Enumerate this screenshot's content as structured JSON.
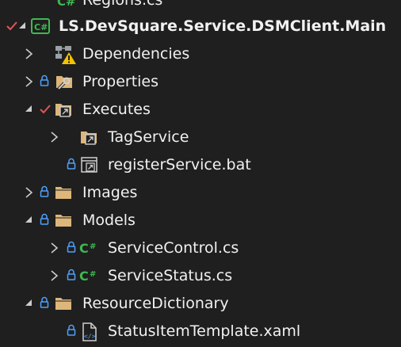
{
  "tree": {
    "top_partial_label": "Regions.cs",
    "project": {
      "label": "LS.DevSquare.Service.DSMClient.Main"
    },
    "items": [
      {
        "label": "Dependencies"
      },
      {
        "label": "Properties"
      },
      {
        "label": "Executes"
      },
      {
        "label": "TagService"
      },
      {
        "label": "registerService.bat"
      },
      {
        "label": "Images"
      },
      {
        "label": "Models"
      },
      {
        "label": "ServiceControl.cs"
      },
      {
        "label": "ServiceStatus.cs"
      },
      {
        "label": "ResourceDictionary"
      },
      {
        "label": "StatusItemTemplate.xaml"
      }
    ]
  },
  "icons": {
    "folder": "folder-icon",
    "csharp_project": "csharp-project-icon",
    "csharp_file": "csharp-file-icon",
    "dependencies": "dependencies-warning-icon",
    "properties": "properties-folder-icon",
    "shortcut_folder": "shortcut-folder-icon",
    "bat_file": "batch-file-icon",
    "xaml_file": "xaml-file-icon",
    "lock": "lock-icon",
    "check": "checkmark-icon"
  },
  "colors": {
    "background": "#1f1f1f",
    "text": "#f1f1f1",
    "folder": "#dcb67a",
    "csharp": "#3fb950",
    "lock": "#4ea1ff",
    "check": "#e05555",
    "warning": "#f4c300"
  }
}
